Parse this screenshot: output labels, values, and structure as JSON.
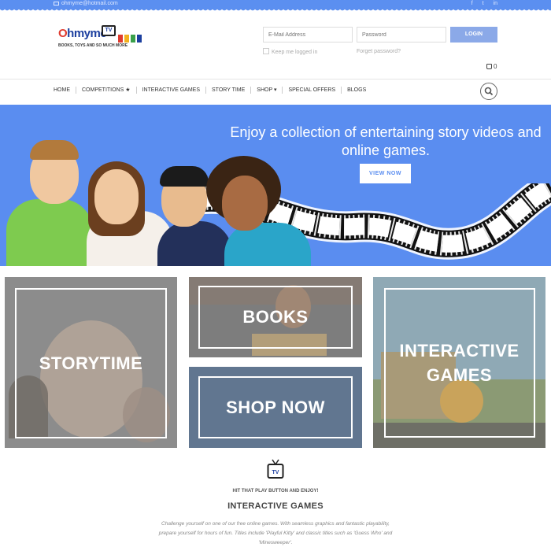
{
  "topbar": {
    "email": "ohmyme@hotmail.com",
    "social": [
      "f",
      "t",
      "in"
    ],
    "color": "#5b8ff0"
  },
  "logo": {
    "brand_o": "O",
    "brand_rest": "hmyme",
    "tv": "TV",
    "tagline": "BOOKS, TOYS AND SO MUCH MORE"
  },
  "login": {
    "email_placeholder": "E-Mail Address",
    "password_placeholder": "Password",
    "button": "LOGIN",
    "keep_logged_in": "Keep me logged in",
    "forgot": "Forget password?"
  },
  "cart": {
    "count": "0",
    "icon": "shopping-bag-icon"
  },
  "nav": {
    "items": [
      "HOME",
      "COMPETITIONS ★",
      "INTERACTIVE GAMES",
      "STORY TIME",
      "SHOP ▾",
      "SPECIAL OFFERS",
      "BLOGS"
    ],
    "search_icon": "search-icon"
  },
  "hero": {
    "title": "Enjoy a collection of entertaining story videos and online games.",
    "button": "VIEW NOW",
    "background": "#5a8df0"
  },
  "tiles": {
    "storytime": "STORYTIME",
    "books": "BOOKS",
    "shop": "SHOP NOW",
    "games": "INTERACTIVE GAMES"
  },
  "section": {
    "icon": "tv-icon",
    "tagline": "HIT THAT PLAY BUTTON AND ENJOY!",
    "title": "INTERACTIVE GAMES",
    "description": "Challenge yourself on one of our free online games. With seamless graphics and fantastic playability, prepare yourself for hours of fun. Titles include 'Playful Kitty' and classic titles such as 'Guess Who' and 'Minesweeper'."
  }
}
